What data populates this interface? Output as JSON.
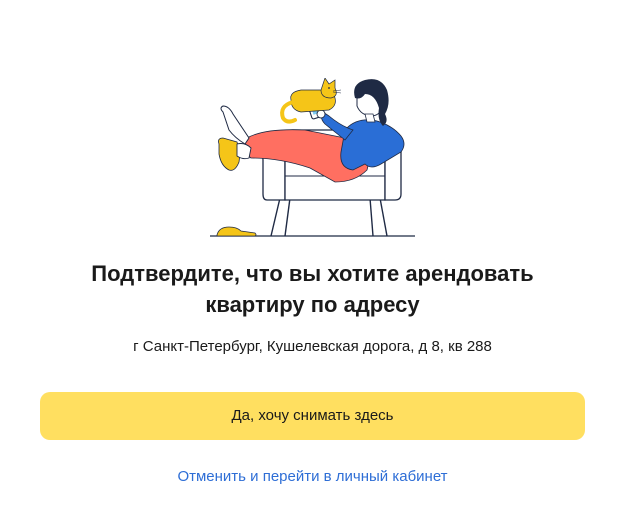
{
  "illustration": {
    "name": "woman-relaxing-in-armchair-with-cat",
    "colors": {
      "shirt": "#2a6ed6",
      "pants": "#ff6f61",
      "cat": "#f5c518",
      "slippers": "#f5c518",
      "outline": "#1f2a44"
    }
  },
  "title": {
    "line1": "Подтвердите, что вы хотите арендовать",
    "line2": "квартиру по адресу"
  },
  "address": "г Санкт-Петербург, Кушелевская дорога, д 8, кв 288",
  "confirm_button": {
    "label": "Да, хочу снимать здесь",
    "color": "#ffdf60"
  },
  "cancel_link": {
    "label": "Отменить и перейти в личный кабинет",
    "color": "#2e6ed6"
  }
}
